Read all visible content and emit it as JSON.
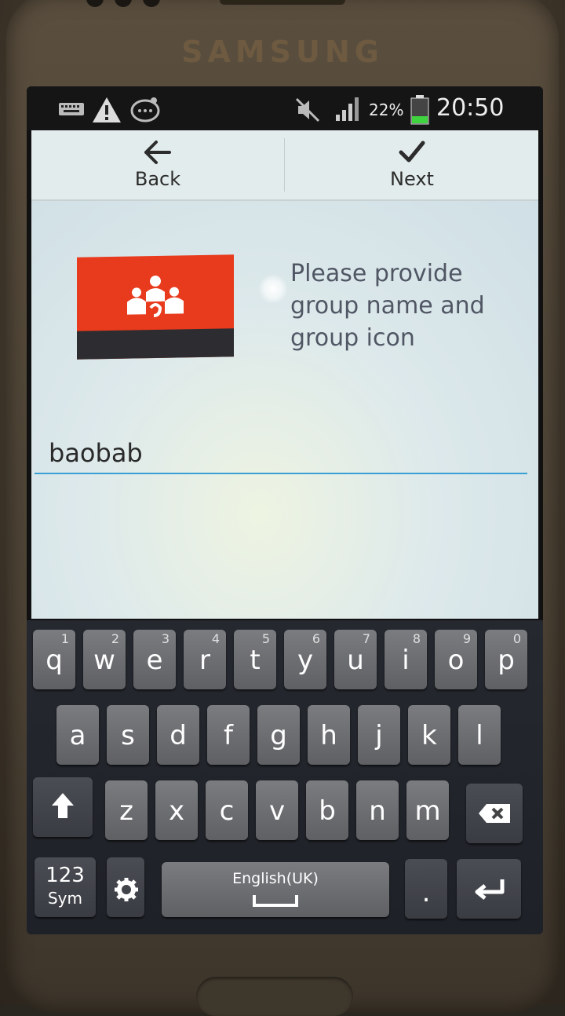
{
  "device": {
    "brand": "SAMSUNG"
  },
  "status_bar": {
    "battery_percent": "22%",
    "time": "20:50"
  },
  "action_bar": {
    "back_label": "Back",
    "next_label": "Next"
  },
  "main": {
    "prompt": "Please provide group name and group icon",
    "group_name_value": "baobab"
  },
  "keyboard": {
    "row1": [
      {
        "ch": "q",
        "num": "1"
      },
      {
        "ch": "w",
        "num": "2"
      },
      {
        "ch": "e",
        "num": "3"
      },
      {
        "ch": "r",
        "num": "4"
      },
      {
        "ch": "t",
        "num": "5"
      },
      {
        "ch": "y",
        "num": "6"
      },
      {
        "ch": "u",
        "num": "7"
      },
      {
        "ch": "i",
        "num": "8"
      },
      {
        "ch": "o",
        "num": "9"
      },
      {
        "ch": "p",
        "num": "0"
      }
    ],
    "row2": [
      "a",
      "s",
      "d",
      "f",
      "g",
      "h",
      "j",
      "k",
      "l"
    ],
    "row3": [
      "z",
      "x",
      "c",
      "v",
      "b",
      "n",
      "m"
    ],
    "sym_label_top": "123",
    "sym_label_bottom": "Sym",
    "space_label": "English(UK)",
    "period": ".",
    "icons": {
      "shift": "shift-arrow-icon",
      "backspace": "backspace-icon",
      "settings": "gear-icon",
      "enter": "enter-icon"
    }
  },
  "colors": {
    "group_icon_bg": "#e83a1c",
    "input_underline": "#3a9fd4",
    "battery": "#3fd33f"
  }
}
